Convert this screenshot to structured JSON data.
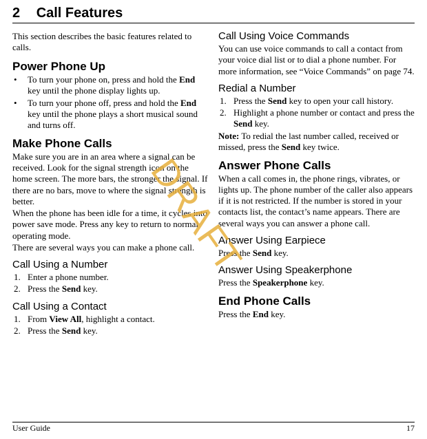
{
  "chapter": {
    "num": "2",
    "title": "Call Features"
  },
  "watermark": "DRAFT",
  "col1": {
    "intro": "This section describes the basic features related to calls.",
    "power": {
      "heading": "Power Phone Up",
      "bullets": [
        {
          "pre": "To turn your phone on, press and hold the ",
          "bold": "End",
          "post": " key until the phone display lights up."
        },
        {
          "pre": "To turn your phone off, press and hold the ",
          "bold": "End",
          "post": " key until the phone plays a short musical sound and turns off."
        }
      ]
    },
    "make": {
      "heading": "Make Phone Calls",
      "p1": "Make sure you are in an area where a signal can be received. Look for the signal strength icon on the home screen. The more bars, the stronger the signal. If there are no bars, move to where the signal strength is better.",
      "p2": "When the phone has been idle for a time, it cycles into power save mode. Press any key to return to normal operating mode.",
      "p3": "There are several ways you can make a phone call."
    },
    "callNum": {
      "heading": "Call Using a Number",
      "s1": "Enter a phone number.",
      "s2pre": "Press the ",
      "s2bold": "Send",
      "s2post": " key."
    },
    "callContact": {
      "heading": "Call Using a Contact",
      "s1pre": "From ",
      "s1bold": "View All",
      "s1post": ", highlight a contact.",
      "s2pre": "Press the ",
      "s2bold": "Send",
      "s2post": " key."
    }
  },
  "col2": {
    "voice": {
      "heading": "Call Using Voice Commands",
      "p": "You can use voice commands to call a contact from your voice dial list or to dial a phone number. For more information, see “Voice Commands” on page 74."
    },
    "redial": {
      "heading": "Redial a Number",
      "s1pre": "Press the ",
      "s1bold": "Send",
      "s1post": " key to open your call history.",
      "s2pre": "Highlight a phone number or contact and press the ",
      "s2bold": "Send",
      "s2post": " key.",
      "noteBold": "Note:",
      "notePre": " To redial the last number called, received or missed, press the ",
      "noteB2": "Send",
      "notePost": " key twice."
    },
    "answer": {
      "heading": "Answer Phone Calls",
      "p": "When a call comes in, the phone rings, vibrates, or lights up. The phone number of the caller also appears if it is not restricted. If the number is stored in your contacts list, the contact’s name appears. There are several ways you can answer a phone call."
    },
    "earpiece": {
      "heading": "Answer Using Earpiece",
      "pre": "Press the ",
      "bold": "Send",
      "post": " key."
    },
    "speaker": {
      "heading": "Answer Using Speakerphone",
      "pre": "Press the ",
      "bold": "Speakerphone",
      "post": " key."
    },
    "end": {
      "heading": "End Phone Calls",
      "pre": "Press the ",
      "bold": "End",
      "post": " key."
    }
  },
  "footer": {
    "left": "User Guide",
    "right": "17"
  }
}
